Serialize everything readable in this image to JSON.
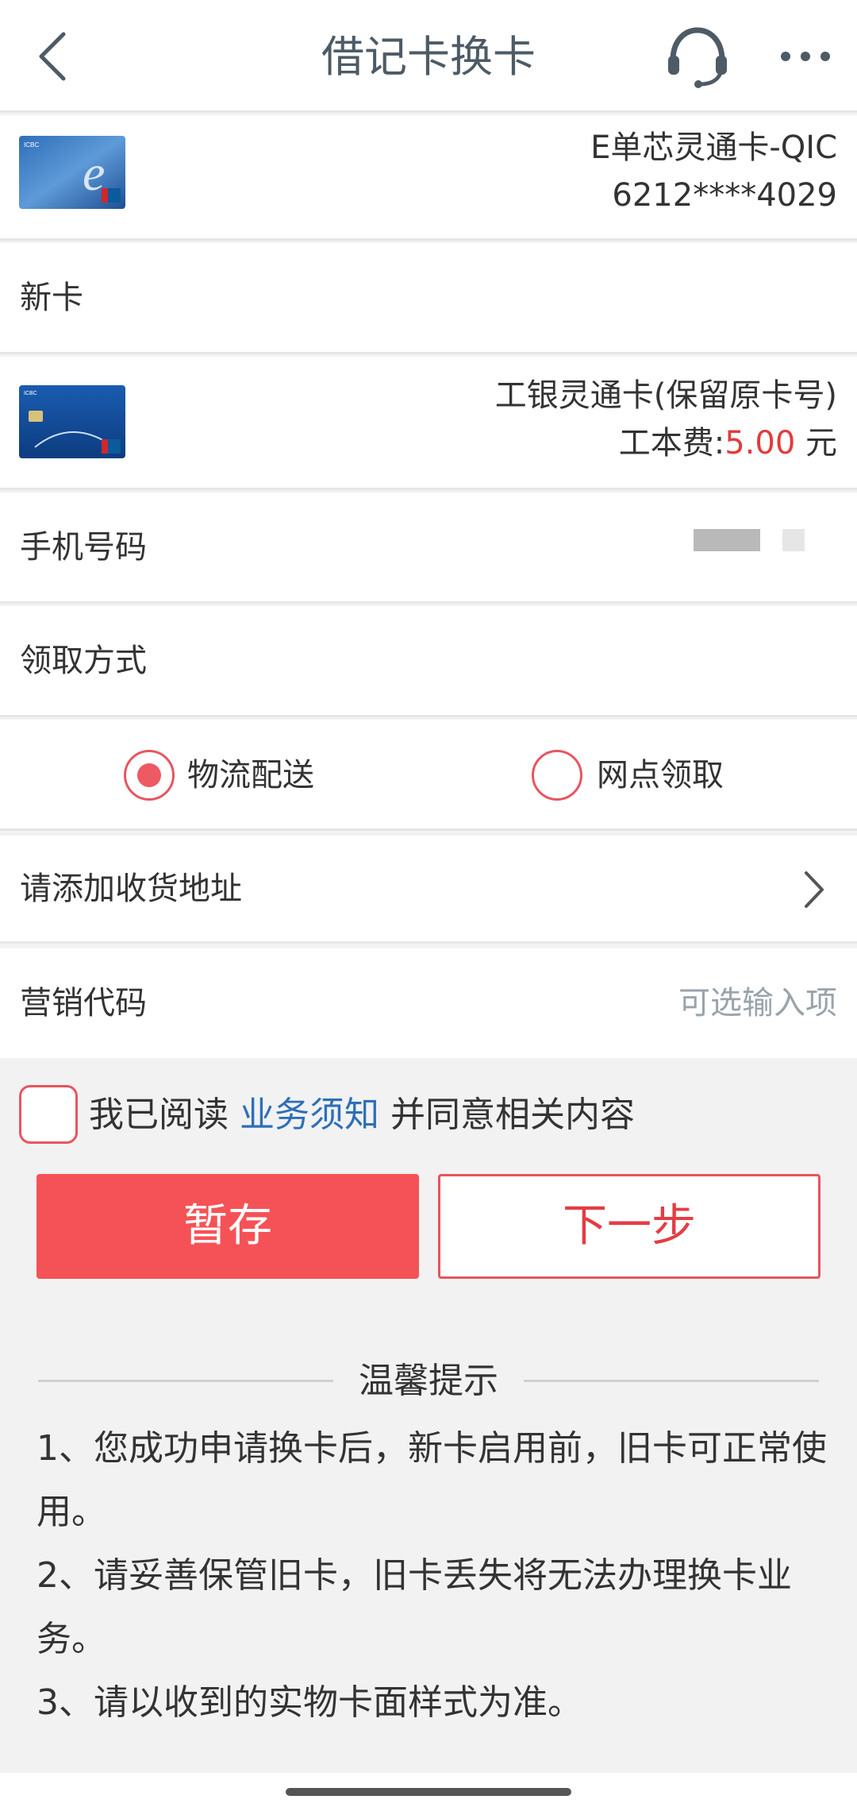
{
  "header": {
    "title": "借记卡换卡",
    "back_icon": "chevron-left-icon",
    "support_icon": "headset-icon",
    "more_icon": "more-dots-icon"
  },
  "old_card": {
    "name": "E单芯灵通卡-QIC",
    "number": "6212****4029"
  },
  "new_card_section": {
    "label": "新卡"
  },
  "new_card": {
    "name": "工银灵通卡(保留原卡号)",
    "fee_label": "工本费:",
    "fee_value": "5.00",
    "fee_unit": " 元"
  },
  "phone": {
    "label": "手机号码"
  },
  "delivery": {
    "label": "领取方式",
    "options": [
      {
        "label": "物流配送",
        "selected": true
      },
      {
        "label": "网点领取",
        "selected": false
      }
    ]
  },
  "address": {
    "label": "请添加收货地址"
  },
  "marketing": {
    "label": "营销代码",
    "placeholder": "可选输入项"
  },
  "agreement": {
    "prefix": "我已阅读 ",
    "link": "业务须知",
    "suffix": " 并同意相关内容",
    "checked": false
  },
  "buttons": {
    "save": "暂存",
    "next": "下一步"
  },
  "tips": {
    "title": "温馨提示",
    "items": [
      "1、您成功申请换卡后，新卡启用前，旧卡可正常使用。",
      "2、请妥善保管旧卡，旧卡丢失将无法办理换卡业务。",
      "3、请以收到的实物卡面样式为准。"
    ]
  },
  "colors": {
    "accent_red": "#f55257",
    "link_blue": "#2d6fb8",
    "title_gray": "#4d5b66"
  }
}
